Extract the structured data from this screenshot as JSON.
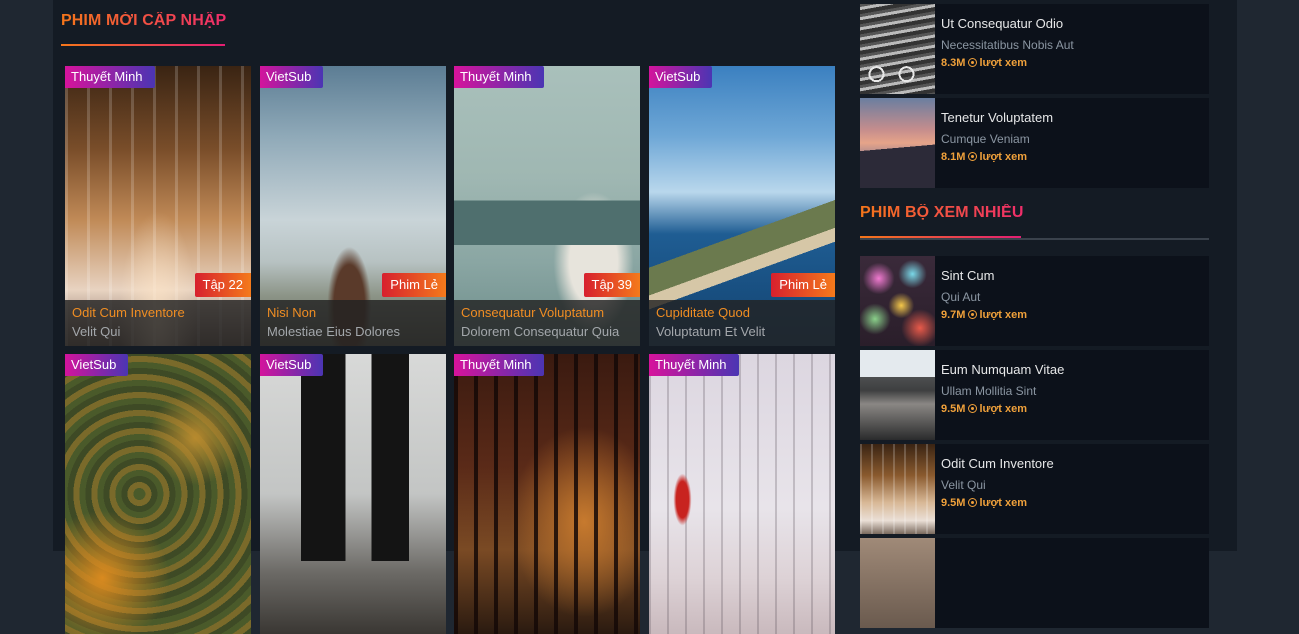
{
  "new_updates": {
    "title": "PHIM MỚI CẬP NHẬP",
    "cards": [
      {
        "badge": "Thuyết Minh",
        "episode": "Tập 22",
        "title": "Odit Cum Inventore",
        "subtitle": "Velit Qui"
      },
      {
        "badge": "VietSub",
        "episode": "Phim Lẻ",
        "title": "Nisi Non",
        "subtitle": "Molestiae Eius Dolores"
      },
      {
        "badge": "Thuyết Minh",
        "episode": "Tập 39",
        "title": "Consequatur Voluptatum",
        "subtitle": "Dolorem Consequatur Quia"
      },
      {
        "badge": "VietSub",
        "episode": "Phim Lẻ",
        "title": "Cupiditate Quod",
        "subtitle": "Voluptatum Et Velit"
      },
      {
        "badge": "VietSub"
      },
      {
        "badge": "VietSub"
      },
      {
        "badge": "Thuyết Minh"
      },
      {
        "badge": "Thuyết Minh"
      }
    ]
  },
  "sidebar_top": {
    "items": [
      {
        "title": "Ut Consequatur Odio",
        "subtitle": "Necessitatibus Nobis Aut",
        "views": "8.3M",
        "views_label": "lượt xem"
      },
      {
        "title": "Tenetur Voluptatem",
        "subtitle": "Cumque Veniam",
        "views": "8.1M",
        "views_label": "lượt xem"
      }
    ]
  },
  "popular_series": {
    "title": "PHIM BỘ XEM NHIỀU",
    "items": [
      {
        "title": "Sint Cum",
        "subtitle": "Qui Aut",
        "views": "9.7M",
        "views_label": "lượt xem"
      },
      {
        "title": "Eum Numquam Vitae",
        "subtitle": "Ullam Mollitia Sint",
        "views": "9.5M",
        "views_label": "lượt xem"
      },
      {
        "title": "Odit Cum Inventore",
        "subtitle": "Velit Qui",
        "views": "9.5M",
        "views_label": "lượt xem"
      }
    ]
  }
}
